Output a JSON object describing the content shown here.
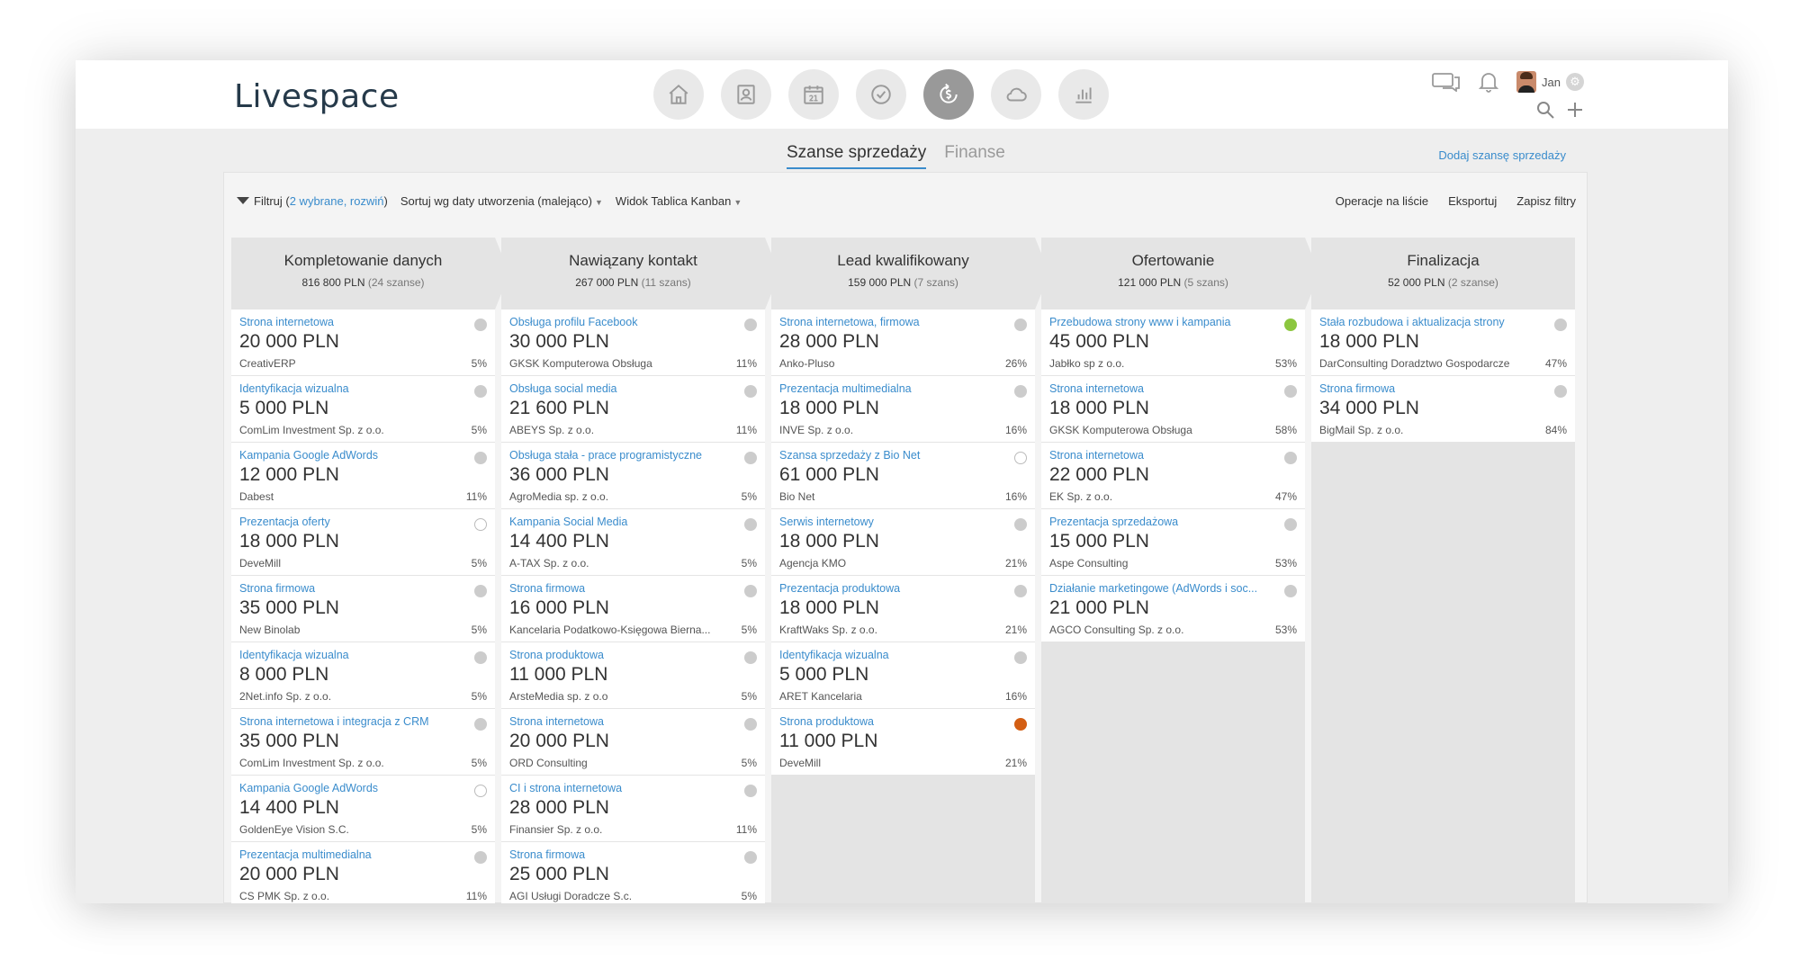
{
  "app": {
    "logo": "Livespace"
  },
  "nav": [
    {
      "name": "home-icon",
      "active": false
    },
    {
      "name": "contacts-icon",
      "active": false
    },
    {
      "name": "calendar-icon",
      "active": false,
      "label": "21"
    },
    {
      "name": "tasks-icon",
      "active": false
    },
    {
      "name": "sales-icon",
      "active": true
    },
    {
      "name": "cloud-icon",
      "active": false
    },
    {
      "name": "reports-icon",
      "active": false
    }
  ],
  "user": {
    "name": "Jan"
  },
  "tabs": [
    {
      "label": "Szanse sprzedaży",
      "active": true
    },
    {
      "label": "Finanse",
      "active": false
    }
  ],
  "add_link": "Dodaj szansę sprzedaży",
  "toolbar": {
    "filter_label": "Filtruj (",
    "filter_link": "2 wybrane, rozwiń",
    "filter_close": ")",
    "sort_label": "Sortuj wg daty utworzenia (malejąco)",
    "view_label": "Widok Tablica Kanban",
    "ops_label": "Operacje na liście",
    "export_label": "Eksportuj",
    "save_filters_label": "Zapisz filtry"
  },
  "colors": {
    "accent": "#3a8ccc",
    "active_tab": "#3a8ccc",
    "green": "#8cc63f",
    "orange": "#d35e13",
    "fab": "#1e9d4a"
  },
  "columns": [
    {
      "title": "Kompletowanie danych",
      "sum": "816 800 PLN",
      "count": "(24 szanse)",
      "cards": [
        {
          "title": "Strona internetowa",
          "amount": "20 000 PLN",
          "company": "CreativERP",
          "pct": "5%",
          "status": "gray"
        },
        {
          "title": "Identyfikacja wizualna",
          "amount": "5 000 PLN",
          "company": "ComLim Investment Sp. z o.o.",
          "pct": "5%",
          "status": "gray"
        },
        {
          "title": "Kampania Google AdWords",
          "amount": "12 000 PLN",
          "company": "Dabest",
          "pct": "11%",
          "status": "gray"
        },
        {
          "title": "Prezentacja oferty",
          "amount": "18 000 PLN",
          "company": "DeveMill",
          "pct": "5%",
          "status": "empty"
        },
        {
          "title": "Strona firmowa",
          "amount": "35 000 PLN",
          "company": "New Binolab",
          "pct": "5%",
          "status": "gray"
        },
        {
          "title": "Identyfikacja wizualna",
          "amount": "8 000 PLN",
          "company": "2Net.info Sp. z o.o.",
          "pct": "5%",
          "status": "gray"
        },
        {
          "title": "Strona internetowa i integracja z CRM",
          "amount": "35 000 PLN",
          "company": "ComLim Investment Sp. z o.o.",
          "pct": "5%",
          "status": "gray"
        },
        {
          "title": "Kampania Google AdWords",
          "amount": "14 400 PLN",
          "company": "GoldenEye Vision S.C.",
          "pct": "5%",
          "status": "empty"
        },
        {
          "title": "Prezentacja multimedialna",
          "amount": "20 000 PLN",
          "company": "CS PMK Sp. z o.o.",
          "pct": "11%",
          "status": "gray"
        }
      ]
    },
    {
      "title": "Nawiązany kontakt",
      "sum": "267 000 PLN",
      "count": "(11 szans)",
      "cards": [
        {
          "title": "Obsługa profilu Facebook",
          "amount": "30 000 PLN",
          "company": "GKSK Komputerowa Obsługa",
          "pct": "11%",
          "status": "gray"
        },
        {
          "title": "Obsługa social media",
          "amount": "21 600 PLN",
          "company": "ABEYS Sp. z o.o.",
          "pct": "11%",
          "status": "gray"
        },
        {
          "title": "Obsługa stała - prace programistyczne",
          "amount": "36 000 PLN",
          "company": "AgroMedia sp. z o.o.",
          "pct": "5%",
          "status": "gray"
        },
        {
          "title": "Kampania Social Media",
          "amount": "14 400 PLN",
          "company": "A-TAX Sp. z o.o.",
          "pct": "5%",
          "status": "gray"
        },
        {
          "title": "Strona firmowa",
          "amount": "16 000 PLN",
          "company": "Kancelaria Podatkowo-Księgowa Bierna...",
          "pct": "5%",
          "status": "gray"
        },
        {
          "title": "Strona produktowa",
          "amount": "11 000 PLN",
          "company": "ArsteMedia sp. z o.o",
          "pct": "5%",
          "status": "gray"
        },
        {
          "title": "Strona internetowa",
          "amount": "20 000 PLN",
          "company": "ORD Consulting",
          "pct": "5%",
          "status": "gray"
        },
        {
          "title": "CI i strona internetowa",
          "amount": "28 000 PLN",
          "company": "Finansier Sp. z o.o.",
          "pct": "11%",
          "status": "gray"
        },
        {
          "title": "Strona firmowa",
          "amount": "25 000 PLN",
          "company": "AGI Usługi Doradcze S.c.",
          "pct": "5%",
          "status": "gray"
        }
      ]
    },
    {
      "title": "Lead kwalifikowany",
      "sum": "159 000 PLN",
      "count": "(7 szans)",
      "cards": [
        {
          "title": "Strona internetowa, firmowa",
          "amount": "28 000 PLN",
          "company": "Anko-Pluso",
          "pct": "26%",
          "status": "gray"
        },
        {
          "title": "Prezentacja multimedialna",
          "amount": "18 000 PLN",
          "company": "INVE Sp. z o.o.",
          "pct": "16%",
          "status": "gray"
        },
        {
          "title": "Szansa sprzedaży z Bio Net",
          "amount": "61 000 PLN",
          "company": "Bio Net",
          "pct": "16%",
          "status": "empty"
        },
        {
          "title": "Serwis internetowy",
          "amount": "18 000 PLN",
          "company": "Agencja KMO",
          "pct": "21%",
          "status": "gray"
        },
        {
          "title": "Prezentacja produktowa",
          "amount": "18 000 PLN",
          "company": "KraftWaks Sp. z o.o.",
          "pct": "21%",
          "status": "gray"
        },
        {
          "title": "Identyfikacja wizualna",
          "amount": "5 000 PLN",
          "company": "ARET Kancelaria",
          "pct": "16%",
          "status": "gray"
        },
        {
          "title": "Strona produktowa",
          "amount": "11 000 PLN",
          "company": "DeveMill",
          "pct": "21%",
          "status": "orange"
        }
      ]
    },
    {
      "title": "Ofertowanie",
      "sum": "121 000 PLN",
      "count": "(5 szans)",
      "cards": [
        {
          "title": "Przebudowa strony www i kampania",
          "amount": "45 000 PLN",
          "company": "Jabłko sp z o.o.",
          "pct": "53%",
          "status": "green"
        },
        {
          "title": "Strona internetowa",
          "amount": "18 000 PLN",
          "company": "GKSK Komputerowa Obsługa",
          "pct": "58%",
          "status": "gray"
        },
        {
          "title": "Strona internetowa",
          "amount": "22 000 PLN",
          "company": "EK Sp. z o.o.",
          "pct": "47%",
          "status": "gray"
        },
        {
          "title": "Prezentacja sprzedażowa",
          "amount": "15 000 PLN",
          "company": "Aspe Consulting",
          "pct": "53%",
          "status": "gray"
        },
        {
          "title": "Działanie marketingowe (AdWords i soc...",
          "amount": "21 000 PLN",
          "company": "AGCO Consulting Sp. z o.o.",
          "pct": "53%",
          "status": "gray"
        }
      ]
    },
    {
      "title": "Finalizacja",
      "sum": "52 000 PLN",
      "count": "(2 szanse)",
      "cards": [
        {
          "title": "Stała rozbudowa i aktualizacja strony",
          "amount": "18 000 PLN",
          "company": "DarConsulting Doradztwo Gospodarcze",
          "pct": "47%",
          "status": "gray"
        },
        {
          "title": "Strona firmowa",
          "amount": "34 000 PLN",
          "company": "BigMail Sp. z o.o.",
          "pct": "84%",
          "status": "gray"
        }
      ]
    }
  ]
}
